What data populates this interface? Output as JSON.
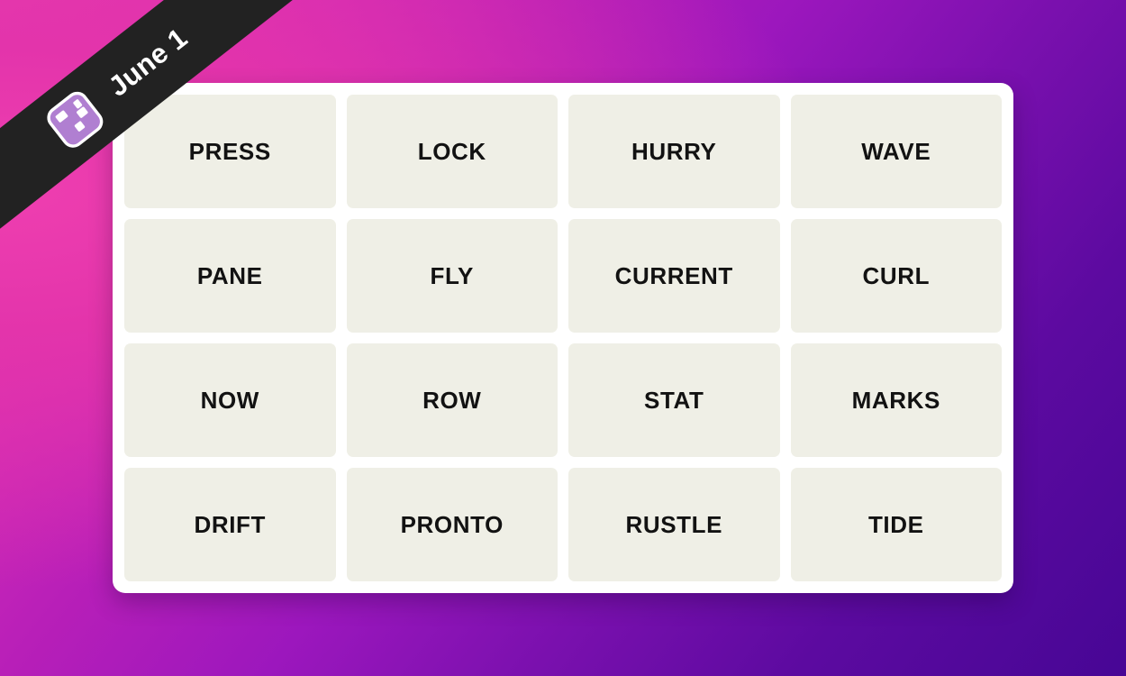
{
  "background": {
    "gradient_from": "#e83fb1",
    "gradient_mid": "#9c17bd",
    "gradient_to": "#470695"
  },
  "banner": {
    "date_label": "June 1",
    "icon_name": "nyt-connections-icon",
    "background_color": "#222222",
    "text_color": "#ffffff"
  },
  "card": {
    "background_color": "#ffffff",
    "tile_color": "#efefe6",
    "tile_text_color": "#121212"
  },
  "grid": {
    "rows": 4,
    "columns": 4,
    "tiles": [
      {
        "word": "PRESS"
      },
      {
        "word": "LOCK"
      },
      {
        "word": "HURRY"
      },
      {
        "word": "WAVE"
      },
      {
        "word": "PANE"
      },
      {
        "word": "FLY"
      },
      {
        "word": "CURRENT"
      },
      {
        "word": "CURL"
      },
      {
        "word": "NOW"
      },
      {
        "word": "ROW"
      },
      {
        "word": "STAT"
      },
      {
        "word": "MARKS"
      },
      {
        "word": "DRIFT"
      },
      {
        "word": "PRONTO"
      },
      {
        "word": "RUSTLE"
      },
      {
        "word": "TIDE"
      }
    ]
  }
}
